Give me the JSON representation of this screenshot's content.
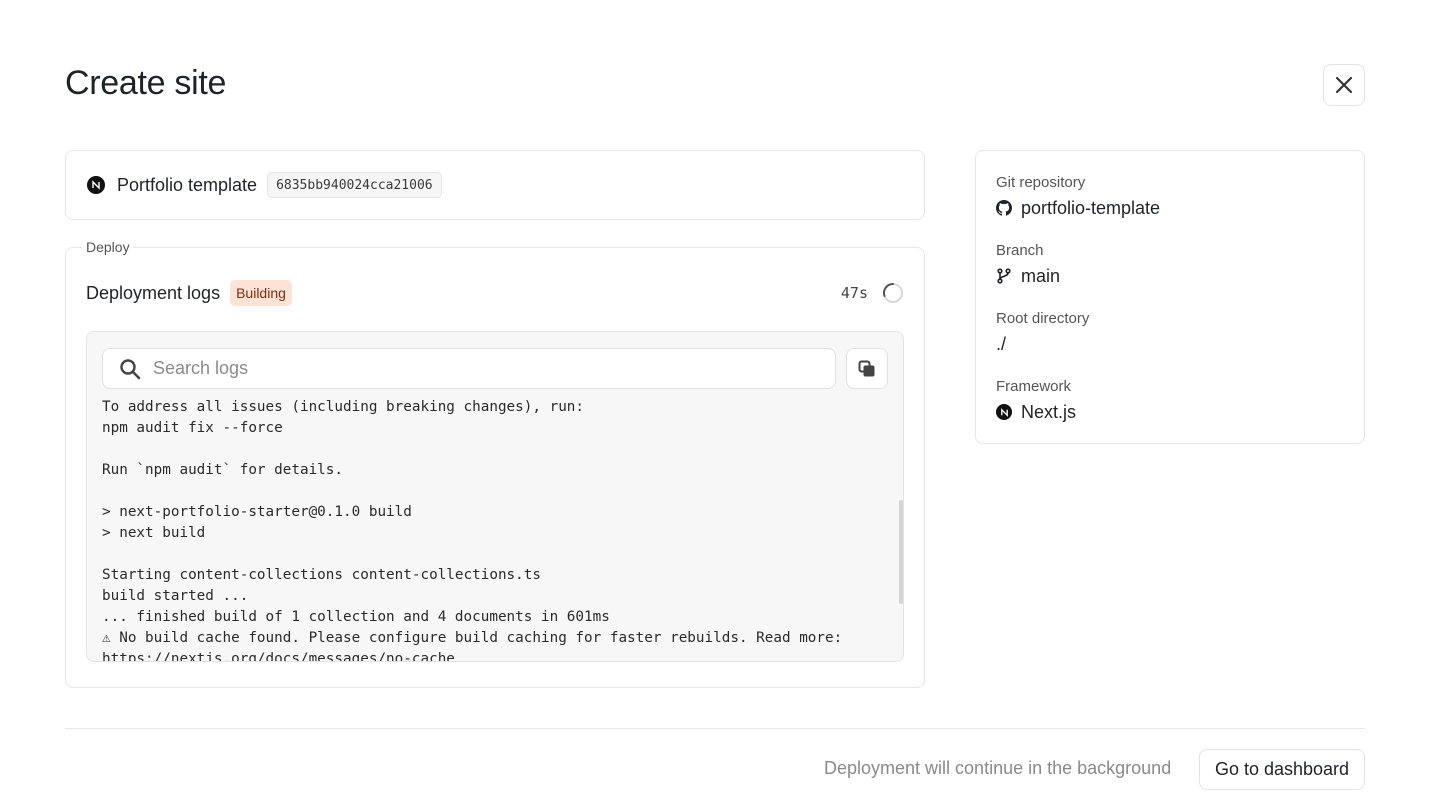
{
  "dialog": {
    "title": "Create site"
  },
  "template": {
    "name": "Portfolio template",
    "hash": "6835bb940024cca21006"
  },
  "deploy": {
    "legend": "Deploy",
    "logs_title": "Deployment logs",
    "status": "Building",
    "elapsed": "47s",
    "search": {
      "placeholder": "Search logs",
      "value": ""
    },
    "log_lines": [
      "To address all issues (including breaking changes), run:",
      "npm audit fix --force",
      "",
      "Run `npm audit` for details.",
      "",
      "> next-portfolio-starter@0.1.0 build",
      "> next build",
      "",
      "Starting content-collections content-collections.ts",
      "build started ...",
      "... finished build of 1 collection and 4 documents in 601ms",
      "⚠ No build cache found. Please configure build caching for faster rebuilds. Read more:",
      "https://nextjs.org/docs/messages/no-cache"
    ]
  },
  "info": {
    "git_repository": {
      "label": "Git repository",
      "value": "portfolio-template",
      "icon": "github-icon"
    },
    "branch": {
      "label": "Branch",
      "value": "main",
      "icon": "git-branch-icon"
    },
    "root_directory": {
      "label": "Root directory",
      "value": "./"
    },
    "framework": {
      "label": "Framework",
      "value": "Next.js",
      "icon": "nextjs-icon"
    }
  },
  "footer": {
    "note": "Deployment will continue in the background",
    "dashboard_button": "Go to dashboard"
  },
  "colors": {
    "badge_bg": "#fde3d6",
    "badge_text": "#7a2e12",
    "panel_bg": "#f7f7f7",
    "border": "#e6e6e6"
  }
}
